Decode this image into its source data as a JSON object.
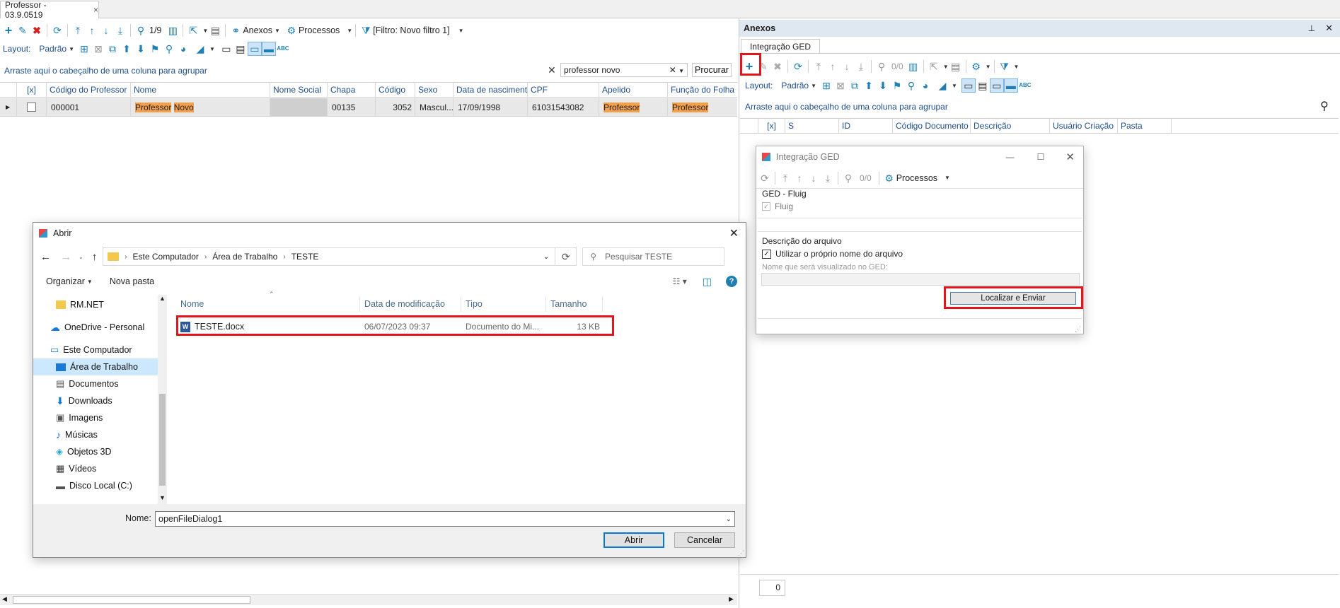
{
  "main": {
    "tab_title": "Professor - 03.9.0519",
    "toolbar": {
      "page_info": "1/9",
      "anexos_label": "Anexos",
      "processos_label": "Processos",
      "filter_label": "[Filtro: Novo filtro 1]"
    },
    "layout_label": "Layout:",
    "layout_value": "Padrão",
    "group_hint": "Arraste aqui o cabeçalho de uma coluna para agrupar",
    "search_value": "professor novo",
    "search_button": "Procurar",
    "columns": [
      "[x]",
      "Código do Professor",
      "Nome",
      "Nome Social",
      "Chapa",
      "Código",
      "Sexo",
      "Data de nascimento",
      "CPF",
      "Apelido",
      "Função do Folha de"
    ],
    "row": {
      "codigo_professor": "000001",
      "nome_1": "Professor",
      "nome_2": "Novo",
      "nome_social": "",
      "chapa": "00135",
      "codigo": "3052",
      "sexo": "Mascul...",
      "data_nascimento": "17/09/1998",
      "cpf": "61031543082",
      "apelido": "Professor",
      "funcao": "Professor"
    }
  },
  "anexos": {
    "title": "Anexos",
    "tab": "Integração GED",
    "page_info": "0/0",
    "layout_label": "Layout:",
    "layout_value": "Padrão",
    "group_hint": "Arraste aqui o cabeçalho de uma coluna para agrupar",
    "columns": [
      "[x]",
      "S",
      "ID",
      "Código Documento",
      "Descrição",
      "Usuário Criação",
      "Pasta"
    ],
    "footer_count": "0"
  },
  "ged_dialog": {
    "title": "Integração GED",
    "page_info": "0/0",
    "processos_label": "Processos",
    "group1": "GED - Fluig",
    "fluig_label": "Fluig",
    "group2": "Descrição do arquivo",
    "use_name_label": "Utilizar o próprio nome do arquivo",
    "name_hint": "Nome que será visualizado no GED:",
    "send_button": "Localizar e Enviar"
  },
  "open_dialog": {
    "title": "Abrir",
    "breadcrumb": [
      "Este Computador",
      "Área de Trabalho",
      "TESTE"
    ],
    "search_placeholder": "Pesquisar TESTE",
    "organizar": "Organizar",
    "nova_pasta": "Nova pasta",
    "sidebar": [
      {
        "label": "RM.NET",
        "icon": "folder-icon"
      },
      {
        "label": "OneDrive - Personal",
        "icon": "cloud-icon"
      },
      {
        "label": "Este Computador",
        "icon": "computer-icon"
      },
      {
        "label": "Área de Trabalho",
        "icon": "desktop-icon"
      },
      {
        "label": "Documentos",
        "icon": "documents-icon"
      },
      {
        "label": "Downloads",
        "icon": "download-icon"
      },
      {
        "label": "Imagens",
        "icon": "images-icon"
      },
      {
        "label": "Músicas",
        "icon": "music-icon"
      },
      {
        "label": "Objetos 3D",
        "icon": "cube-icon"
      },
      {
        "label": "Vídeos",
        "icon": "video-icon"
      },
      {
        "label": "Disco Local (C:)",
        "icon": "drive-icon"
      }
    ],
    "columns": [
      "Nome",
      "Data de modificação",
      "Tipo",
      "Tamanho"
    ],
    "file": {
      "name": "TESTE.docx",
      "modified": "06/07/2023 09:37",
      "type": "Documento do Mi...",
      "size": "13 KB"
    },
    "name_label": "Nome:",
    "name_value": "openFileDialog1",
    "open_button": "Abrir",
    "cancel_button": "Cancelar"
  },
  "colors": {
    "accent": "#1f7fb5",
    "highlight": "#f5a04a",
    "red_marker": "#e3141b",
    "selected": "#cce8ff"
  }
}
